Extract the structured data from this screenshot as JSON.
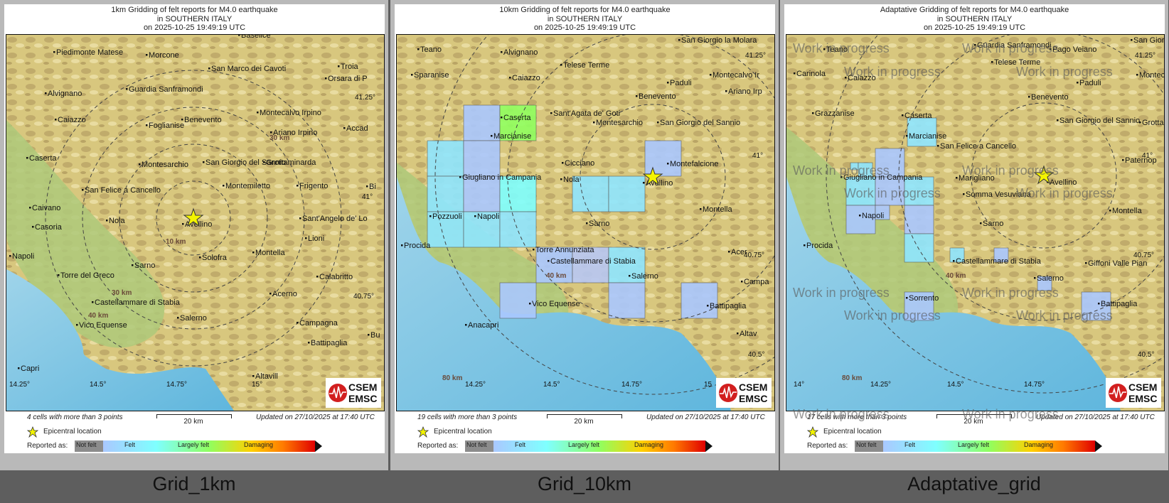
{
  "panels": [
    {
      "title": [
        "1km Gridding of felt reports for M4.0 earthquake",
        "in SOUTHERN ITALY",
        "on  2025-10-25 19:49:19 UTC"
      ],
      "caption": "Grid_1km",
      "cells_text": "4 cells with more than 3 points",
      "updated_text": "Updated on 27/10/2025 at 17:40 UTC",
      "scale_label": "20 km",
      "epicenter_label": "Epicentral location",
      "reported_as": "Reported as:",
      "places": [
        "Piedimonte Matese",
        "Morcone",
        "San Marco dei Cavoti",
        "Troia",
        "Orsara di P",
        "Alvignano",
        "Guardia Sanframondi",
        "Caiazzo",
        "Foglianise",
        "Montecalvo Irpino",
        "Benevento",
        "Ariano Irpino",
        "Accad",
        "Caserta",
        "Montesarchio",
        "San Giorgio del Sannio",
        "Grottaminarda",
        "San Felice a Cancello",
        "Montemiletto",
        "Frigento",
        "Bi",
        "Caivano",
        "Nola",
        "Avellino",
        "Sant'Angelo de' Lo",
        "Casoria",
        "Lioni",
        "Napoli",
        "Montella",
        "Solofra",
        "Sarno",
        "Torre del Greco",
        "Calabritto",
        "Castellammare di Stabia",
        "Acerno",
        "Salerno",
        "Campagna",
        "Vico Equense",
        "Battipaglia",
        "Bu",
        "Capri",
        "Altavill",
        "Baselice"
      ],
      "ticks": [
        "14.25°",
        "14.5°",
        "14.75°",
        "15°",
        "41.25°",
        "41°",
        "40.75°"
      ],
      "rings": [
        "10 km",
        "30 km",
        "30 km",
        "40 km"
      ]
    },
    {
      "title": [
        "10km Gridding of felt reports for M4.0 earthquake",
        "in SOUTHERN ITALY",
        "on  2025-10-25 19:49:19 UTC"
      ],
      "caption": "Grid_10km",
      "cells_text": "19 cells with more than 3 points",
      "updated_text": "Updated on 27/10/2025 at 17:40 UTC",
      "scale_label": "20 km",
      "epicenter_label": "Epicentral location",
      "reported_as": "Reported as:",
      "places": [
        "Teano",
        "Alvignano",
        "San Giorgio la Molara",
        "Sparanise",
        "Caiazzo",
        "Telese Terme",
        "Montecalvo Ir",
        "Paduli",
        "Ariano Irp",
        "Caserta",
        "Sant'Agata de' Goti",
        "Benevento",
        "Marcianise",
        "Montesarchio",
        "San Giorgio del Sannio",
        "Cicciano",
        "Montefalcione",
        "Giugliano in Campania",
        "Nola",
        "Avellino",
        "Pozzuoli",
        "Napoli",
        "Montella",
        "Sarno",
        "Procida",
        "Torre Annunziata",
        "Castellammare di Stabia",
        "Acer",
        "Salerno",
        "Campa",
        "Vico Equense",
        "Battipaglia",
        "Anacapri",
        "Altav"
      ],
      "ticks": [
        "14.25°",
        "14.5°",
        "14.75°",
        "15",
        "41.25°",
        "41°",
        "40.75°",
        "40.5°"
      ],
      "rings": [
        "40 km",
        "80 km"
      ]
    },
    {
      "title": [
        "Adaptative Gridding of felt reports for M4.0 earthquake",
        "in SOUTHERN ITALY",
        "on  2025-10-25 19:49:19 UTC"
      ],
      "caption": "Adaptative_grid",
      "cells_text": "17 cells with more than 3 points",
      "updated_text": "Updated on 27/10/2025 at 17:40 UTC",
      "scale_label": "20 km",
      "epicenter_label": "Epicentral location",
      "reported_as": "Reported as:",
      "places": [
        "Teano",
        "Guardia Sanframondi",
        "Pago Veiano",
        "San Giorgio",
        "Carinola",
        "Telese Terme",
        "Montecal",
        "Caiazzo",
        "Paduli",
        "Benevento",
        "Grazzanise",
        "Caserta",
        "San Giorgio del Sannio",
        "Grotta",
        "Marcianise",
        "San Felice a Cancello",
        "Paternop",
        "Giugliano in Campania",
        "Marigliano",
        "Avellino",
        "Somma Vesuviana",
        "Napoli",
        "Montella",
        "Sarno",
        "Procida",
        "Castellammare di Stabia",
        "Giffoni Valle Pian",
        "Salerno",
        "Sorrento",
        "Battipaglia"
      ],
      "ticks": [
        "14°",
        "14.25°",
        "14.5°",
        "14.75°",
        "41.25°",
        "41°",
        "40.75°",
        "40.5°"
      ],
      "rings": [
        "40 km",
        "80 km"
      ],
      "watermark": "Work in progress"
    }
  ],
  "legend": {
    "labels": [
      "Not felt",
      "Felt",
      "Largely felt",
      "Damaging"
    ],
    "colors": [
      "#8c8c8c",
      "#aac8ff",
      "#7fffff",
      "#90ff60",
      "#ffd000",
      "#ff7a00",
      "#e00000"
    ]
  },
  "logo": {
    "line1": "CSEM",
    "line2": "EMSC"
  }
}
